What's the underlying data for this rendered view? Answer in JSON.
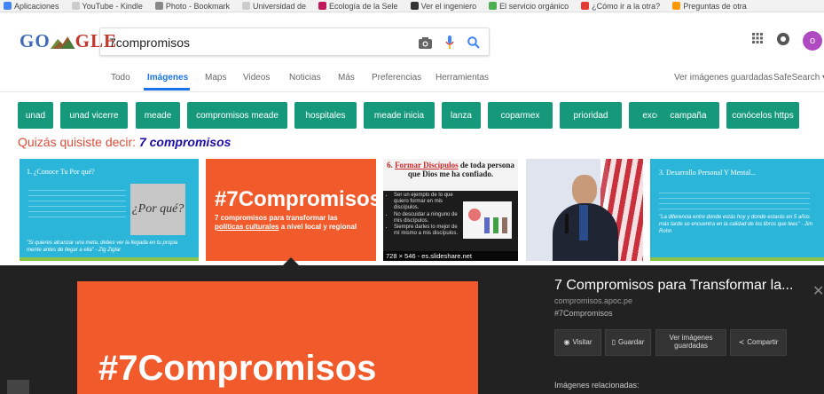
{
  "bookmarks": [
    "Aplicaciones",
    "YouTube - Kindle",
    "Photo - Bookmark",
    "Universidad de",
    "Ecología de la Sele",
    "Ver el ingeniero",
    "El servicio orgánico",
    "¿Cómo ir a la otra?",
    "Preguntas de otra"
  ],
  "logo": {
    "text_left": "GO",
    "text_right": "GLE"
  },
  "search": {
    "value": "7compromisos"
  },
  "nav": {
    "tabs": [
      "Todo",
      "Imágenes",
      "Maps",
      "Videos",
      "Noticias",
      "Más",
      "Preferencias",
      "Herramientas"
    ],
    "saved_images": "Ver imágenes guardadas",
    "safesearch": "SafeSearch ▾"
  },
  "avatar_letter": "o",
  "chips": [
    "unad",
    "unad vicerre",
    "meade",
    "compromisos meade",
    "hospitales",
    "meade inicia",
    "lanza",
    "coparmex",
    "prioridad",
    "excelencia",
    "campaña",
    "conócelos https"
  ],
  "did_you_mean": {
    "prefix": "Quizás quisiste decir:",
    "suggestion": "7 compromisos"
  },
  "thumbs": {
    "t1_title": "1. ¿Conoce Tu Por qué?",
    "t1_sign": "¿Por qué?",
    "t1_quote": "\"Si quieres alcanzar una meta, debes ver la llegada en tu propia mente antes de llegar a ella\" - Zig Ziglar",
    "t2_title": "#7Compromisos",
    "t2_sub_line1": "7 compromisos para transformar las",
    "t2_sub_line2_ul": "políticas culturales",
    "t2_sub_line2_rest": " a nivel local y regional",
    "t3_num": "6.",
    "t3_head_ul": "Formar Discípulos",
    "t3_head_rest": " de toda persona que Dios me ha confiado.",
    "t3_bullets": [
      "Ser un ejemplo de lo que quiero formar en mis discípulos.",
      "No descuidar a ninguno de mis discípulos.",
      "Siempre darles lo mejor de mí mismo a mis discípulos."
    ],
    "t3_caption": "728 × 546 - es.slideshare.net",
    "t5_title": "3. Desarrollo Personal Y Mental...",
    "t5_quote": "\"La diferencia entre donde estás hoy y donde estarás en 5 años más tarde se encuentra en la calidad de los libros que lees\" - Jim Rohn"
  },
  "panel": {
    "preview_text": "#7Compromisos",
    "title": "7 Compromisos para Transformar la...",
    "domain": "compromisos.apoc.pe",
    "tag": "#7Compromisos",
    "btn_visit": "Visitar",
    "btn_save": "Guardar",
    "btn_view_saved": "Ver imágenes guardadas",
    "btn_share": "Compartir",
    "related": "Imágenes relacionadas:"
  },
  "colors": {
    "accent": "#1a73e8",
    "chip": "#16997b",
    "orange": "#f15a2b",
    "cyan": "#2bb5d8",
    "panel": "#222222"
  }
}
